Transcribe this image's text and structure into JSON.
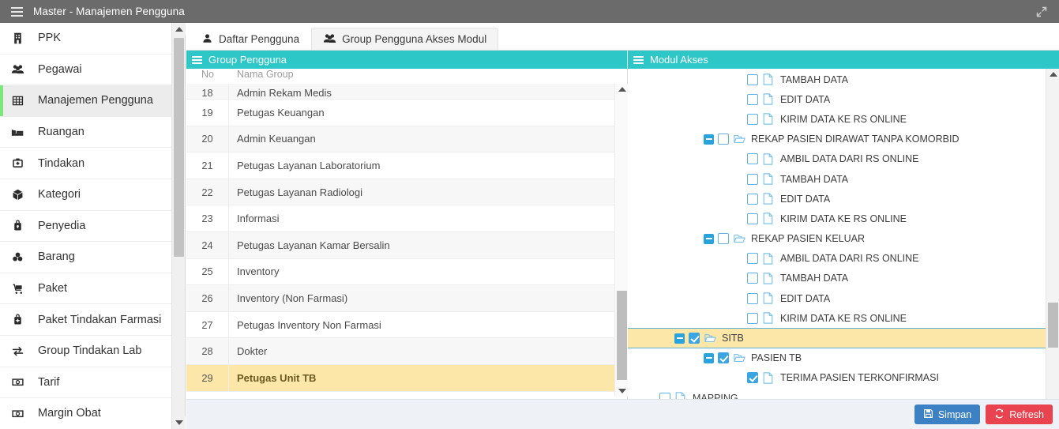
{
  "window": {
    "title": "Master - Manajemen Pengguna",
    "menu_icon": "hamburger-icon",
    "expand_icon": "expand-arrows-icon",
    "titlebar_color": "#6b6b6b"
  },
  "sidebar": {
    "accent_color": "#7ce87c",
    "items": [
      {
        "label": "PPK",
        "icon": "building-icon",
        "active": false
      },
      {
        "label": "Pegawai",
        "icon": "users-icon",
        "active": false
      },
      {
        "label": "Manajemen Pengguna",
        "icon": "table-grid-icon",
        "active": true
      },
      {
        "label": "Ruangan",
        "icon": "bed-icon",
        "active": false
      },
      {
        "label": "Tindakan",
        "icon": "medical-kit-icon",
        "active": false
      },
      {
        "label": "Kategori",
        "icon": "cube-icon",
        "active": false
      },
      {
        "label": "Penyedia",
        "icon": "supplier-icon",
        "active": false
      },
      {
        "label": "Barang",
        "icon": "boxes-icon",
        "active": false
      },
      {
        "label": "Paket",
        "icon": "cart-icon",
        "active": false
      },
      {
        "label": "Paket Tindakan Farmasi",
        "icon": "pharmacy-icon",
        "active": false
      },
      {
        "label": "Group Tindakan Lab",
        "icon": "exchange-arrows-icon",
        "active": false
      },
      {
        "label": "Tarif",
        "icon": "money-icon",
        "active": false
      },
      {
        "label": "Margin Obat",
        "icon": "money-icon",
        "active": false
      }
    ]
  },
  "tabs": [
    {
      "label": "Daftar Pengguna",
      "icon": "user-icon",
      "active": false
    },
    {
      "label": "Group Pengguna Akses Modul",
      "icon": "users-icon",
      "active": true
    }
  ],
  "left_panel": {
    "header": "Group Pengguna",
    "header_icon": "list-icon",
    "header_color": "#2ec7c7",
    "columns": {
      "no": "No",
      "name": "Nama Group"
    },
    "rows": [
      {
        "no": "18",
        "name": "Admin Rekam Medis",
        "selected": false,
        "clipped": true
      },
      {
        "no": "19",
        "name": "Petugas Keuangan",
        "selected": false
      },
      {
        "no": "20",
        "name": "Admin Keuangan",
        "selected": false
      },
      {
        "no": "21",
        "name": "Petugas Layanan Laboratorium",
        "selected": false
      },
      {
        "no": "22",
        "name": "Petugas Layanan Radiologi",
        "selected": false
      },
      {
        "no": "23",
        "name": "Informasi",
        "selected": false
      },
      {
        "no": "24",
        "name": "Petugas Layanan Kamar Bersalin",
        "selected": false
      },
      {
        "no": "25",
        "name": "Inventory",
        "selected": false
      },
      {
        "no": "26",
        "name": "Inventory (Non Farmasi)",
        "selected": false
      },
      {
        "no": "27",
        "name": "Petugas Inventory Non Farmasi",
        "selected": false
      },
      {
        "no": "28",
        "name": "Dokter",
        "selected": false
      },
      {
        "no": "29",
        "name": "Petugas Unit TB",
        "selected": true
      }
    ]
  },
  "right_panel": {
    "header": "Modul Akses",
    "header_icon": "list-icon",
    "header_color": "#2ec7c7",
    "nodes": [
      {
        "label": "TAMBAH DATA",
        "indent": 3,
        "toggle": "none",
        "checked": false,
        "icon": "file-icon",
        "selected": false
      },
      {
        "label": "EDIT DATA",
        "indent": 3,
        "toggle": "none",
        "checked": false,
        "icon": "file-icon",
        "selected": false
      },
      {
        "label": "KIRIM DATA KE RS ONLINE",
        "indent": 3,
        "toggle": "none",
        "checked": false,
        "icon": "file-icon",
        "selected": false
      },
      {
        "label": "REKAP PASIEN DIRAWAT TANPA KOMORBID",
        "indent": 2,
        "toggle": "minus",
        "checked": false,
        "icon": "folder-icon",
        "selected": false
      },
      {
        "label": "AMBIL DATA DARI RS ONLINE",
        "indent": 3,
        "toggle": "none",
        "checked": false,
        "icon": "file-icon",
        "selected": false
      },
      {
        "label": "TAMBAH DATA",
        "indent": 3,
        "toggle": "none",
        "checked": false,
        "icon": "file-icon",
        "selected": false
      },
      {
        "label": "EDIT DATA",
        "indent": 3,
        "toggle": "none",
        "checked": false,
        "icon": "file-icon",
        "selected": false
      },
      {
        "label": "KIRIM DATA KE RS ONLINE",
        "indent": 3,
        "toggle": "none",
        "checked": false,
        "icon": "file-icon",
        "selected": false
      },
      {
        "label": "REKAP PASIEN KELUAR",
        "indent": 2,
        "toggle": "minus",
        "checked": false,
        "icon": "folder-icon",
        "selected": false
      },
      {
        "label": "AMBIL DATA DARI RS ONLINE",
        "indent": 3,
        "toggle": "none",
        "checked": false,
        "icon": "file-icon",
        "selected": false
      },
      {
        "label": "TAMBAH DATA",
        "indent": 3,
        "toggle": "none",
        "checked": false,
        "icon": "file-icon",
        "selected": false
      },
      {
        "label": "EDIT DATA",
        "indent": 3,
        "toggle": "none",
        "checked": false,
        "icon": "file-icon",
        "selected": false
      },
      {
        "label": "KIRIM DATA KE RS ONLINE",
        "indent": 3,
        "toggle": "none",
        "checked": false,
        "icon": "file-icon",
        "selected": false
      },
      {
        "label": "SITB",
        "indent": 1,
        "toggle": "minus",
        "checked": true,
        "icon": "folder-icon",
        "selected": true
      },
      {
        "label": "PASIEN TB",
        "indent": 2,
        "toggle": "minus",
        "checked": true,
        "icon": "folder-icon",
        "selected": false
      },
      {
        "label": "TERIMA PASIEN TERKONFIRMASI",
        "indent": 3,
        "toggle": "none",
        "checked": true,
        "icon": "file-icon",
        "selected": false
      },
      {
        "label": "MAPPING",
        "indent": 0,
        "toggle": "none",
        "checked": false,
        "icon": "file-icon",
        "selected": false
      }
    ]
  },
  "footer": {
    "save_label": "Simpan",
    "save_icon": "save-disk-icon",
    "save_color": "#3c81c4",
    "refresh_label": "Refresh",
    "refresh_icon": "refresh-icon",
    "refresh_color": "#e8434f"
  }
}
